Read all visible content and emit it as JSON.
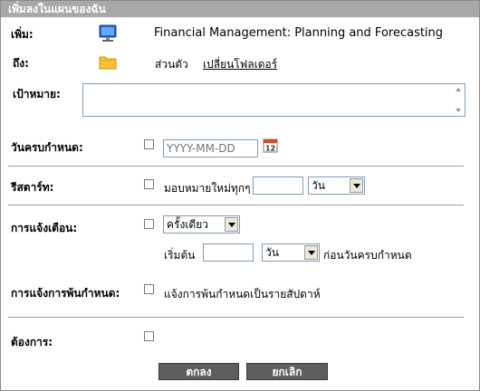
{
  "dialog": {
    "title": "เพิ่มลงในแผนของฉัน"
  },
  "add_row": {
    "label": "เพิ่ม:",
    "icon": "computer-monitor-icon",
    "value": "Financial Management: Planning and Forecasting"
  },
  "to_row": {
    "label": "ถึง:",
    "icon": "folder-icon",
    "folder": "ส่วนตัว",
    "change_link": "เปลี่ยนโฟลเดอร์"
  },
  "goal": {
    "label": "เป้าหมาย:",
    "value": ""
  },
  "due_date": {
    "label": "วันครบกำหนด:",
    "placeholder": "YYYY-MM-DD",
    "calendar_icon": "calendar-icon",
    "calendar_day": "12"
  },
  "restart": {
    "label": "รีสตาร์ท:",
    "text": "มอบหมายใหม่ทุกๆ",
    "value": "",
    "unit": "วัน"
  },
  "reminder": {
    "label": "การแจ้งเตือน:",
    "frequency": "ครั้งเดียว",
    "start_label": "เริ่มต้น",
    "start_value": "",
    "unit": "วัน",
    "suffix": "ก่อนวันครบกำหนด"
  },
  "overdue": {
    "label": "การแจ้งการพ้นกำหนด:",
    "text": "แจ้งการพ้นกำหนดเป็นรายสัปดาห์"
  },
  "required": {
    "label": "ต้องการ:"
  },
  "buttons": {
    "ok": "ตกลง",
    "cancel": "ยกเลิก"
  },
  "colors": {
    "titlebar": "#a8a8a8",
    "button": "#5e5e5e",
    "divider": "#9a9a9a"
  }
}
